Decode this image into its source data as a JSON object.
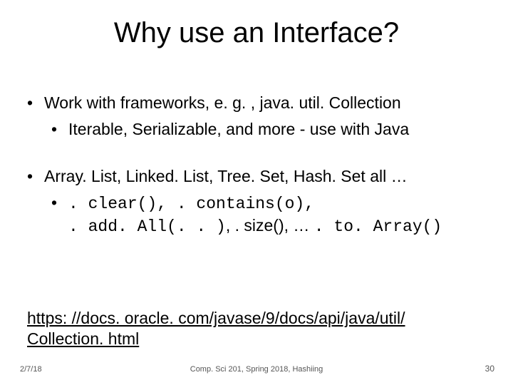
{
  "title": "Why use an Interface?",
  "bullets": {
    "b1": "Work with frameworks, e. g. , java. util. Collection",
    "b1a": "Iterable, Serializable, and more - use with Java",
    "b2": "Array. List, Linked. List, Tree. Set, Hash. Set all …",
    "b2a_code_line1": ". clear(), . contains(o),",
    "b2a_line2_code1": ". add. All(. . )",
    "b2a_line2_mid": ", . size(), … ",
    "b2a_line2_code2": ". to. Array()"
  },
  "link": "https: //docs. oracle. com/javase/9/docs/api/java/util/ Collection. html",
  "footer": {
    "date": "2/7/18",
    "center": "Comp. Sci 201, Spring 2018,  Hashiing",
    "page": "30"
  }
}
